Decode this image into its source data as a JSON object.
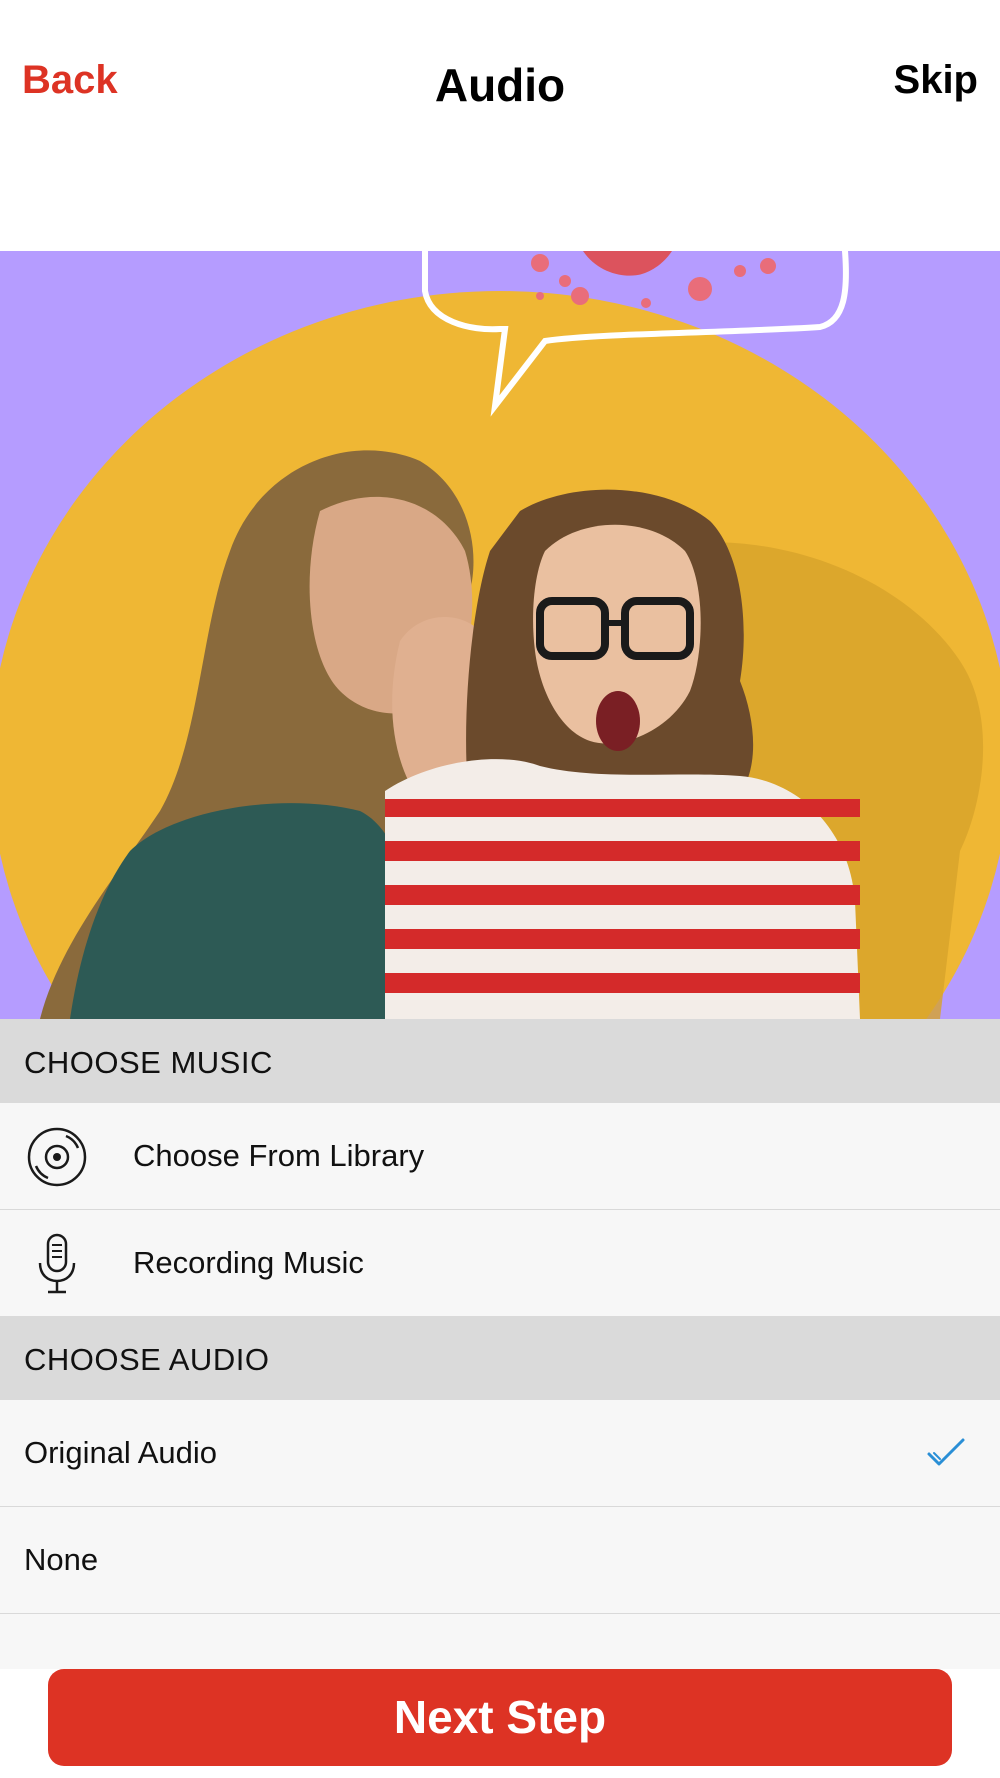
{
  "nav": {
    "back_label": "Back",
    "title": "Audio",
    "skip_label": "Skip"
  },
  "sections": {
    "music": {
      "header": "CHOOSE MUSIC",
      "items": [
        {
          "label": "Choose From Library",
          "icon": "vinyl-disc-icon"
        },
        {
          "label": "Recording Music",
          "icon": "microphone-icon"
        }
      ]
    },
    "audio": {
      "header": "CHOOSE AUDIO",
      "items": [
        {
          "label": "Original Audio",
          "selected": true
        },
        {
          "label": "None",
          "selected": false
        }
      ]
    }
  },
  "footer": {
    "next_label": "Next Step"
  },
  "colors": {
    "accent": "#dd3324",
    "preview_background": "#b59cff",
    "circle": "#efb734",
    "check": "#2a8fd6",
    "section_header": "#dadada"
  }
}
